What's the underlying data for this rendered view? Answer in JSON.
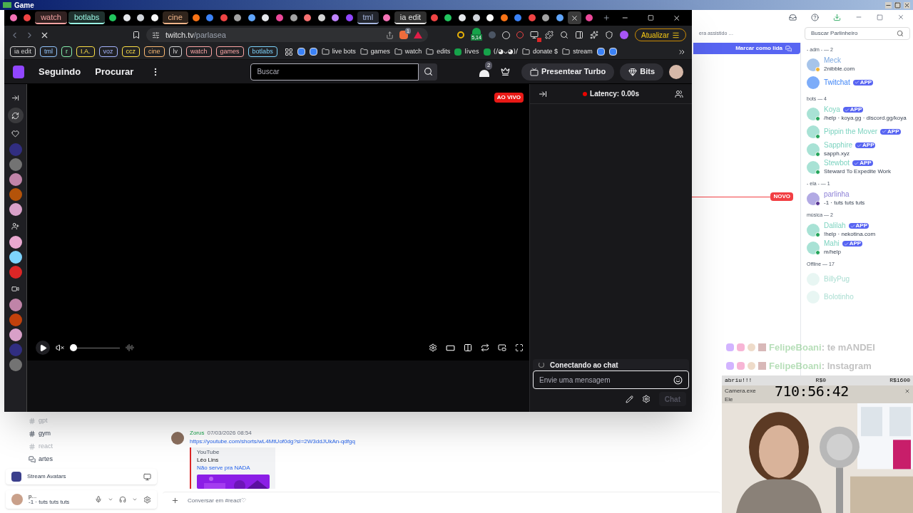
{
  "desktop": {
    "title": "Game"
  },
  "browser": {
    "tabs": [
      {
        "kind": "icon",
        "selected": false
      },
      {
        "kind": "icon",
        "selected": false
      },
      {
        "kind": "text",
        "label": "watch",
        "color": "#f3a3a3",
        "selected": false
      },
      {
        "kind": "text",
        "label": "botlabs",
        "color": "#99f6e4",
        "selected": false
      },
      {
        "kind": "icon",
        "selected": false
      },
      {
        "kind": "icon",
        "selected": false
      },
      {
        "kind": "icon",
        "selected": false
      },
      {
        "kind": "icon",
        "selected": false
      },
      {
        "kind": "text",
        "label": "cine",
        "color": "#f0b58a",
        "selected": false
      },
      {
        "kind": "icon",
        "selected": false
      },
      {
        "kind": "icon",
        "selected": false
      },
      {
        "kind": "icon",
        "selected": false
      },
      {
        "kind": "icon",
        "selected": false
      },
      {
        "kind": "icon",
        "selected": false
      },
      {
        "kind": "icon",
        "selected": false
      },
      {
        "kind": "icon",
        "selected": false
      },
      {
        "kind": "icon",
        "selected": false
      },
      {
        "kind": "icon",
        "selected": false
      },
      {
        "kind": "icon",
        "selected": false
      },
      {
        "kind": "icon",
        "selected": false
      },
      {
        "kind": "icon",
        "selected": false
      },
      {
        "kind": "text",
        "label": "tml",
        "color": "#a8b8e0",
        "selected": false
      },
      {
        "kind": "icon",
        "selected": false
      },
      {
        "kind": "text",
        "label": "ia edit",
        "color": "#e5e5e5",
        "selected": false
      },
      {
        "kind": "icon",
        "selected": false
      },
      {
        "kind": "icon",
        "selected": false
      },
      {
        "kind": "icon",
        "selected": false
      },
      {
        "kind": "icon",
        "selected": false
      },
      {
        "kind": "icon",
        "selected": false
      },
      {
        "kind": "icon",
        "selected": false
      },
      {
        "kind": "icon",
        "selected": false
      },
      {
        "kind": "icon",
        "selected": false
      },
      {
        "kind": "icon",
        "selected": false
      },
      {
        "kind": "icon",
        "selected": false
      },
      {
        "kind": "icon",
        "selected": true
      },
      {
        "kind": "icon",
        "selected": false
      }
    ],
    "address": {
      "host": "twitch.tv",
      "path": "/parlasea"
    },
    "extension_badge": "1",
    "counter_badge": "5,14",
    "update_button": "Atualizar",
    "bookmark_groups": [
      {
        "label": "ia edit",
        "color": "#d4d4d4"
      },
      {
        "label": "tml",
        "color": "#93c5fd"
      },
      {
        "label": "r",
        "color": "#86efac"
      },
      {
        "label": "I.A.",
        "color": "#fde047"
      },
      {
        "label": "voz",
        "color": "#a5b4fc"
      },
      {
        "label": "ccz",
        "color": "#fde047"
      },
      {
        "label": "cine",
        "color": "#fdba74"
      },
      {
        "label": "lv",
        "color": "#d4d4d4"
      },
      {
        "label": "watch",
        "color": "#fca5a5"
      },
      {
        "label": "games",
        "color": "#fca5a5"
      },
      {
        "label": "botlabs",
        "color": "#7dd3fc"
      }
    ],
    "bookmarks": [
      {
        "kind": "apps"
      },
      {
        "kind": "site"
      },
      {
        "kind": "site"
      },
      {
        "kind": "folder",
        "label": "live bots"
      },
      {
        "kind": "folder",
        "label": "games"
      },
      {
        "kind": "folder",
        "label": "watch"
      },
      {
        "kind": "folder",
        "label": "edits"
      },
      {
        "kind": "site",
        "label": "lives"
      },
      {
        "kind": "site",
        "label": "(/◕ᴗ◕)/"
      },
      {
        "kind": "folder",
        "label": "donate $"
      },
      {
        "kind": "folder",
        "label": "stream"
      },
      {
        "kind": "site"
      },
      {
        "kind": "site"
      }
    ]
  },
  "twitch": {
    "nav": [
      "Seguindo",
      "Procurar"
    ],
    "search": {
      "placeholder": "Buscar"
    },
    "notification_count": "2",
    "turbo_button": "Presentear Turbo",
    "bits_button": "Bits",
    "sidebar": [
      {
        "kind": "collapse",
        "selected": false
      },
      {
        "kind": "recommended",
        "selected": true
      },
      {
        "kind": "following",
        "selected": false
      },
      {
        "kind": "avatar",
        "selected": false
      },
      {
        "kind": "avatar",
        "selected": false
      },
      {
        "kind": "avatar",
        "selected": false
      },
      {
        "kind": "avatar",
        "selected": false
      },
      {
        "kind": "avatar",
        "selected": false
      },
      {
        "kind": "add",
        "selected": false
      },
      {
        "kind": "avatar",
        "selected": false
      },
      {
        "kind": "avatar",
        "selected": false
      },
      {
        "kind": "avatar",
        "selected": false
      },
      {
        "kind": "video",
        "selected": false
      },
      {
        "kind": "avatar",
        "selected": false
      },
      {
        "kind": "avatar",
        "selected": false
      },
      {
        "kind": "avatar",
        "selected": false
      },
      {
        "kind": "avatar",
        "selected": false
      },
      {
        "kind": "avatar",
        "selected": false
      }
    ],
    "live_badge": "AO VIVO",
    "volume": {
      "level": 0
    },
    "latency": "Latency: 0.00s",
    "chat_status": "Conectando ao chat",
    "chat_input": {
      "placeholder": "Envie uma mensagem"
    },
    "chat_button": "Chat"
  },
  "discord": {
    "header_text": "era assistido …",
    "search": {
      "placeholder": "Buscar Parlinheiro"
    },
    "banner": "Marcar como lida",
    "new_divider": "NOVO",
    "channels": [
      {
        "name": "gpt",
        "kind": "text",
        "unread": false
      },
      {
        "name": "gym",
        "kind": "text",
        "unread": true
      },
      {
        "name": "react",
        "kind": "text",
        "unread": false
      },
      {
        "name": "artes",
        "kind": "forum",
        "unread": true
      }
    ],
    "stream_avatars": "Stream Avatars",
    "user": {
      "name": "p...",
      "status": "-1 · tuts tuts tuts"
    },
    "message": {
      "author": "Zorus",
      "time": "07/03/2026 08:54",
      "link": "https://youtube.com/shorts/wL4MtUof0dg?si=2W3ddJUkAn-qdfgq",
      "embed": {
        "provider": "YouTube",
        "author": "Léo Lins",
        "title": "Não serve pra NADA"
      }
    },
    "composer": {
      "placeholder": "Conversar em #react♡"
    },
    "member_groups": [
      {
        "title": "- adm - — 2",
        "members": [
          {
            "name": "Meck",
            "subtitle": "2nibble.com",
            "kind": "idle",
            "color": "#7aa7e0"
          },
          {
            "name": "Twitchat",
            "tag": "APP",
            "kind": "bot",
            "color": "#3b82f6"
          }
        ]
      },
      {
        "title": "bots — 4",
        "members": [
          {
            "name": "Koya",
            "subtitle": "/help · koya.gg · discord.gg/koya",
            "tag": "APP",
            "kind": "online",
            "color": "#7dd3c0"
          },
          {
            "name": "Pippin the Mover",
            "tag": "APP",
            "kind": "online",
            "color": "#7dd3c0"
          },
          {
            "name": "Sapphire",
            "subtitle": "sapph.xyz",
            "tag": "APP",
            "kind": "online",
            "color": "#7dd3c0"
          },
          {
            "name": "Stewbot",
            "subtitle": "Steward To Expedite Work",
            "tag": "APP",
            "kind": "online",
            "color": "#7dd3c0"
          }
        ]
      },
      {
        "title": "- ela - — 1",
        "members": [
          {
            "name": "parlinha",
            "subtitle": "-1 · tuts tuts tuts",
            "kind": "streaming",
            "color": "#8b7fd6"
          }
        ]
      },
      {
        "title": "música — 2",
        "members": [
          {
            "name": "Dalilah",
            "subtitle": "!help · nekotina.com",
            "tag": "APP",
            "kind": "online",
            "color": "#7dd3c0"
          },
          {
            "name": "Mahi",
            "subtitle": "m/help",
            "tag": "APP",
            "kind": "online",
            "color": "#7dd3c0"
          }
        ]
      },
      {
        "title": "Offline — 17",
        "members": [
          {
            "name": "BillyPug",
            "kind": "offline",
            "color": "#a9ddd1"
          },
          {
            "name": "Bolotinho",
            "kind": "offline",
            "color": "#a9ddd1"
          }
        ]
      }
    ]
  },
  "overlay_chat": [
    {
      "user": "FelipeBoani",
      "text": ": te mANDEI"
    },
    {
      "user": "FelipeBoani",
      "text": ": Instagram"
    }
  ],
  "webcam": {
    "goal_label": "abriu!!!",
    "current": "R$0",
    "target": "R$1600",
    "title": "Camera.exe",
    "timer": "710:56:42",
    "menu": "Ele"
  }
}
